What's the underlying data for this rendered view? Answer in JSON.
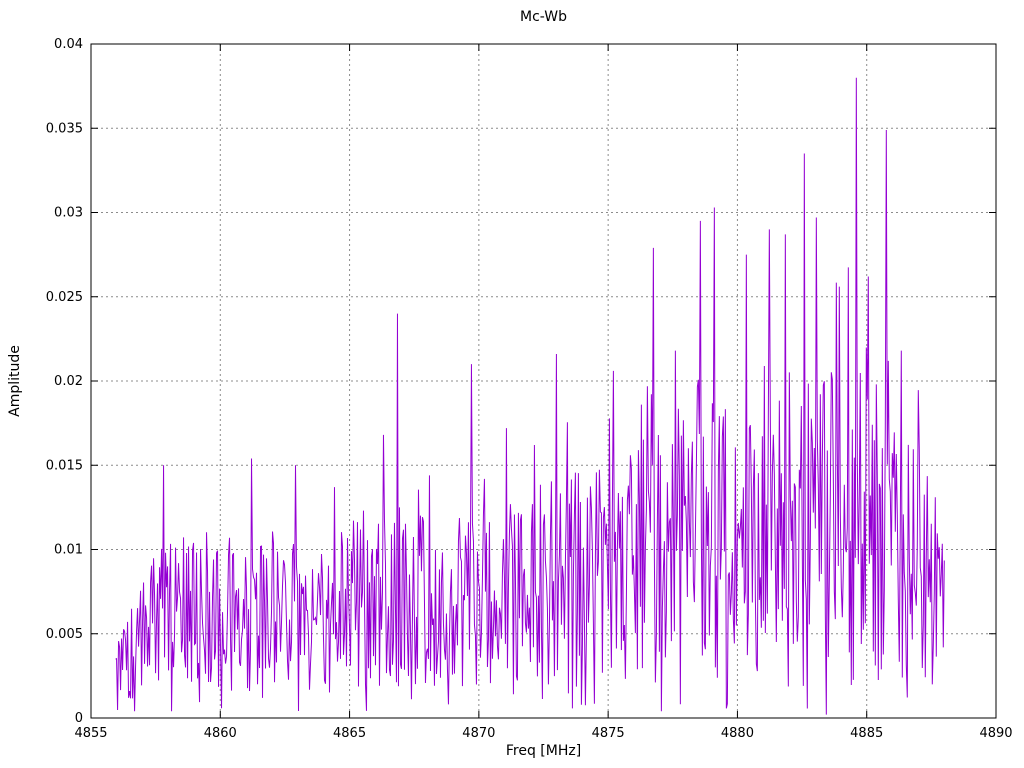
{
  "chart_data": {
    "type": "line",
    "title": "Mc-Wb",
    "xlabel": "Freq [MHz]",
    "ylabel": "Amplitude",
    "xlim": [
      4855,
      4890
    ],
    "ylim": [
      0,
      0.04
    ],
    "xticks": {
      "values": [
        4855,
        4860,
        4865,
        4870,
        4875,
        4880,
        4885,
        4890
      ],
      "labels": [
        "4855",
        "4860",
        "4865",
        "4870",
        "4875",
        "4880",
        "4885",
        "4890"
      ]
    },
    "yticks": {
      "values": [
        0,
        0.005,
        0.01,
        0.015,
        0.02,
        0.025,
        0.03,
        0.035,
        0.04
      ],
      "labels": [
        "0",
        "0.005",
        "0.01",
        "0.015",
        "0.02",
        "0.025",
        "0.03",
        "0.035",
        "0.04"
      ]
    },
    "grid": true,
    "legend": "none",
    "line_color": "#9400d3",
    "grid_color": "#8c8c8c",
    "frame_color": "#000000",
    "tick_len": 7,
    "series": [
      {
        "name": "Mc-Wb spectrum",
        "x_start": 4855.95,
        "x_end": 4888.0,
        "n_points": 830,
        "seed": 20240907,
        "envelope_mean": [
          [
            4855.95,
            0.003
          ],
          [
            4856.4,
            0.004
          ],
          [
            4857.0,
            0.0055
          ],
          [
            4857.6,
            0.0068
          ],
          [
            4858.6,
            0.0078
          ],
          [
            4859.6,
            0.0072
          ],
          [
            4860.6,
            0.0068
          ],
          [
            4861.6,
            0.0072
          ],
          [
            4862.6,
            0.007
          ],
          [
            4863.6,
            0.006
          ],
          [
            4864.6,
            0.0068
          ],
          [
            4865.6,
            0.0077
          ],
          [
            4867.0,
            0.0078
          ],
          [
            4868.5,
            0.0071
          ],
          [
            4870.0,
            0.0076
          ],
          [
            4871.5,
            0.0079
          ],
          [
            4873.0,
            0.0088
          ],
          [
            4874.5,
            0.0092
          ],
          [
            4876.0,
            0.0103
          ],
          [
            4877.5,
            0.0118
          ],
          [
            4878.8,
            0.0126
          ],
          [
            4880.0,
            0.0108
          ],
          [
            4881.3,
            0.0136
          ],
          [
            4882.8,
            0.0133
          ],
          [
            4884.3,
            0.0143
          ],
          [
            4885.5,
            0.0139
          ],
          [
            4886.6,
            0.0116
          ],
          [
            4887.6,
            0.0086
          ],
          [
            4888.0,
            0.0076
          ]
        ],
        "noise_low": 0.22,
        "noise_high": 1.62,
        "dip_prob": 0.045,
        "dip_factor": 0.14,
        "spike_prob": 0.035,
        "spike_factor": 1.25,
        "value_clamp": [
          0.0004,
          0.0395
        ],
        "major_peaks": [
          [
            4857.8,
            0.015
          ],
          [
            4861.2,
            0.0154
          ],
          [
            4862.9,
            0.015
          ],
          [
            4864.4,
            0.0137
          ],
          [
            4866.3,
            0.0168
          ],
          [
            4866.85,
            0.024
          ],
          [
            4868.1,
            0.0144
          ],
          [
            4869.7,
            0.021
          ],
          [
            4871.05,
            0.0172
          ],
          [
            4873.0,
            0.0216
          ],
          [
            4875.2,
            0.0206
          ],
          [
            4876.3,
            0.0186
          ],
          [
            4876.75,
            0.0279
          ],
          [
            4877.6,
            0.0218
          ],
          [
            4878.55,
            0.0295
          ],
          [
            4879.1,
            0.0303
          ],
          [
            4880.35,
            0.0275
          ],
          [
            4881.25,
            0.029
          ],
          [
            4881.85,
            0.0287
          ],
          [
            4882.6,
            0.0335
          ],
          [
            4883.05,
            0.0297
          ],
          [
            4883.45,
            0.0002
          ],
          [
            4883.95,
            0.0256
          ],
          [
            4884.6,
            0.038
          ],
          [
            4885.05,
            0.0262
          ],
          [
            4885.75,
            0.0349
          ],
          [
            4886.35,
            0.0218
          ],
          [
            4887.65,
            0.0131
          ]
        ]
      }
    ]
  }
}
